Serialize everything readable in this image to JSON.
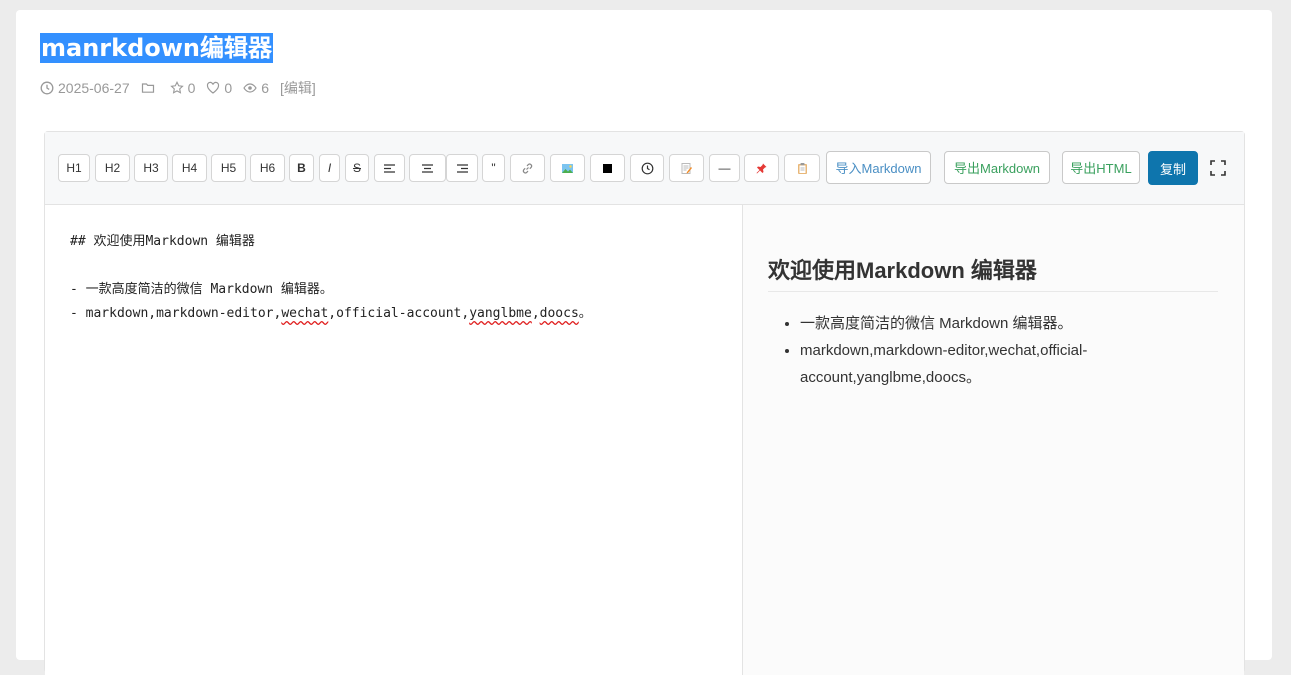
{
  "article": {
    "title": "manrkdown编辑器",
    "date": "2025-06-27",
    "stars": "0",
    "likes": "0",
    "views": "6",
    "edit_label": "[编辑]"
  },
  "toolbar": {
    "h1": "H1",
    "h2": "H2",
    "h3": "H3",
    "h4": "H4",
    "h5": "H5",
    "h6": "H6",
    "bold": "B",
    "italic": "I",
    "strike": "S",
    "quote": "\"",
    "hr": "—",
    "import": "导入Markdown",
    "export_md": "导出Markdown",
    "export_html": "导出HTML",
    "copy": "复制"
  },
  "source": {
    "line1": "## 欢迎使用Markdown 编辑器",
    "line2": "- 一款高度简洁的微信 Markdown 编辑器。",
    "line3_a": "- markdown,markdown-editor,",
    "line3_b": "wechat",
    "line3_c": ",official-account,",
    "line3_d": "yanglbme",
    "line3_e": ",",
    "line3_f": "doocs",
    "line3_g": "。"
  },
  "preview": {
    "heading": "欢迎使用Markdown 编辑器",
    "items": [
      "一款高度简洁的微信 Markdown 编辑器。",
      "markdown,markdown-editor,wechat,official-account,yanglbme,doocs。"
    ]
  },
  "colors": {
    "primary": "#0e75ad",
    "export_green": "#3aa05e",
    "import_blue": "#4a8fc4",
    "title_highlight": "#3390ff"
  }
}
